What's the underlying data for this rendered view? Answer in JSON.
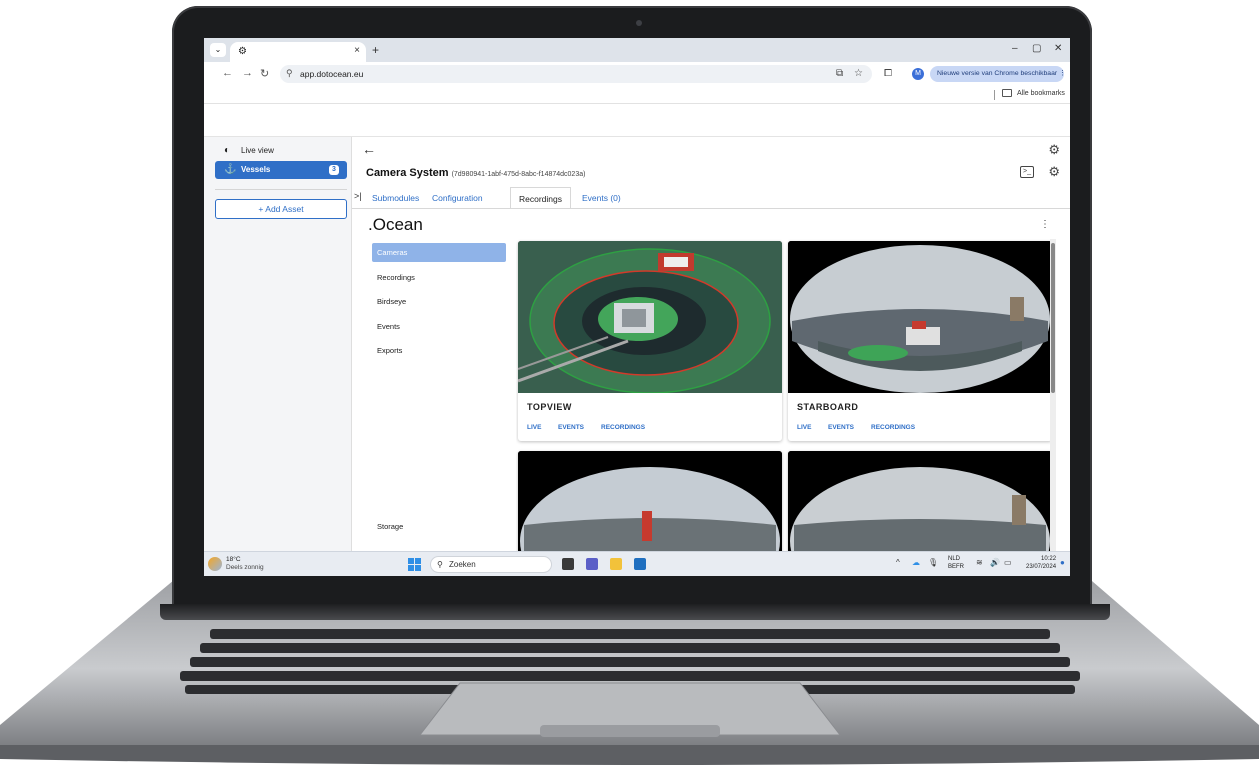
{
  "browser": {
    "tab_close": "×",
    "new_tab": "+",
    "url": "app.dotocean.eu",
    "update_button": "Nieuwe versie van Chrome beschikbaar",
    "profile_initial": "M",
    "bookmarks_label": "Alle bookmarks"
  },
  "sidebar": {
    "items": [
      {
        "label": "Live view"
      },
      {
        "label": "Vessels",
        "badge": "3"
      }
    ],
    "add_asset": "+ Add Asset"
  },
  "header": {
    "title": "Camera System",
    "id": "(7d980941-1abf-475d-8abc-f14874dc023a)"
  },
  "tabs": [
    {
      "label": "Submodules"
    },
    {
      "label": "Configuration"
    },
    {
      "label": "Recordings"
    },
    {
      "label": "Events (0)"
    }
  ],
  "ocean": {
    "logo": ".Ocean",
    "nav": [
      {
        "label": "Cameras"
      },
      {
        "label": "Recordings"
      },
      {
        "label": "Birdseye"
      },
      {
        "label": "Events"
      },
      {
        "label": "Exports"
      }
    ],
    "storage": "Storage",
    "cameras": [
      {
        "title": "TOPVIEW",
        "links": [
          "LIVE",
          "EVENTS",
          "RECORDINGS"
        ]
      },
      {
        "title": "STARBOARD",
        "links": [
          "LIVE",
          "EVENTS",
          "RECORDINGS"
        ]
      }
    ]
  },
  "taskbar": {
    "temperature": "18°C",
    "weather": "Deels zonnig",
    "search_placeholder": "Zoeken",
    "lang_1": "NLD",
    "lang_2": "BEFR",
    "time": "10:22",
    "date": "23/07/2024"
  },
  "colors": {
    "accent": "#2f6fc7",
    "nav_active": "#8fb3e8"
  }
}
